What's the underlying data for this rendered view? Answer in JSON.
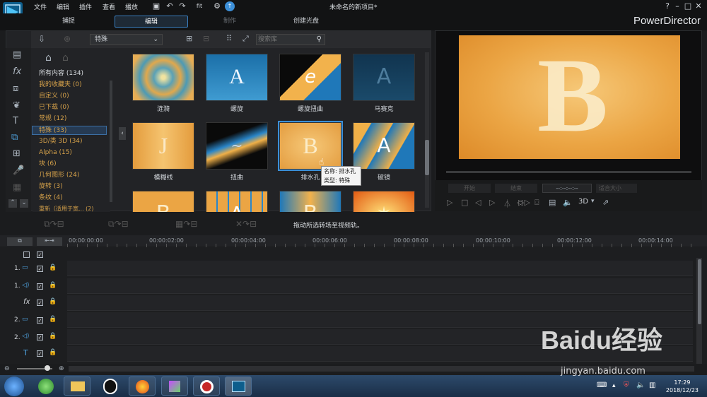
{
  "menu": [
    "文件",
    "编辑",
    "插件",
    "查看",
    "播放"
  ],
  "window_title": "未命名的新项目*",
  "zoom_label": "fit",
  "modes": {
    "capture": "捕捉",
    "edit": "编辑",
    "produce": "制作",
    "create_disc": "创建光盘"
  },
  "brand": "PowerDirector",
  "library": {
    "dropdown": "特殊",
    "search_placeholder": "搜索库",
    "categories": [
      "所有内容 (134)",
      "我的收藏夹 (0)",
      "自定义 (0)",
      "已下载 (0)",
      "常规 (12)",
      "特殊 (33)",
      "3D/类 3D (34)",
      "Alpha (15)",
      "块 (6)",
      "几何图形 (24)",
      "旋转 (3)",
      "条纹 (4)",
      "重新（适用于宽... (2)"
    ],
    "thumbnails": [
      {
        "label": "涟漪",
        "glyph": "☉"
      },
      {
        "label": "螺旋",
        "glyph": "A"
      },
      {
        "label": "螺旋扭曲",
        "glyph": "e"
      },
      {
        "label": "马赛克",
        "glyph": "A"
      },
      {
        "label": "模糊线",
        "glyph": "J"
      },
      {
        "label": "扭曲",
        "glyph": "~"
      },
      {
        "label": "排水孔",
        "glyph": "B"
      },
      {
        "label": "破镜",
        "glyph": "A"
      },
      {
        "label": "",
        "glyph": "B"
      },
      {
        "label": "",
        "glyph": "A"
      },
      {
        "label": "",
        "glyph": "B"
      },
      {
        "label": "",
        "glyph": "✶"
      }
    ],
    "tooltip_name": "名称: 排水孔",
    "tooltip_type": "类型: 特殊"
  },
  "preview": {
    "letter": "B",
    "timecode": "--:--:--:--",
    "size_label": "适合大小",
    "three_d": "3D",
    "mark_in": "开始",
    "mark_out": "结束"
  },
  "hint": "拖动所选转场至视频轨。",
  "timeline": {
    "timecodes": [
      "00:00:00:00",
      "00:00:02:00",
      "00:00:04:00",
      "00:00:06:00",
      "00:00:08:00",
      "00:00:10:00",
      "00:00:12:00",
      "00:00:14:00"
    ],
    "tracks": [
      "1.",
      "1.",
      "",
      "2.",
      "2.",
      "",
      ""
    ]
  },
  "taskbar": {
    "time": "17:29",
    "date": "2018/12/23"
  },
  "watermark": {
    "brand": "Baidu经验",
    "url": "jingyan.baidu.com"
  }
}
